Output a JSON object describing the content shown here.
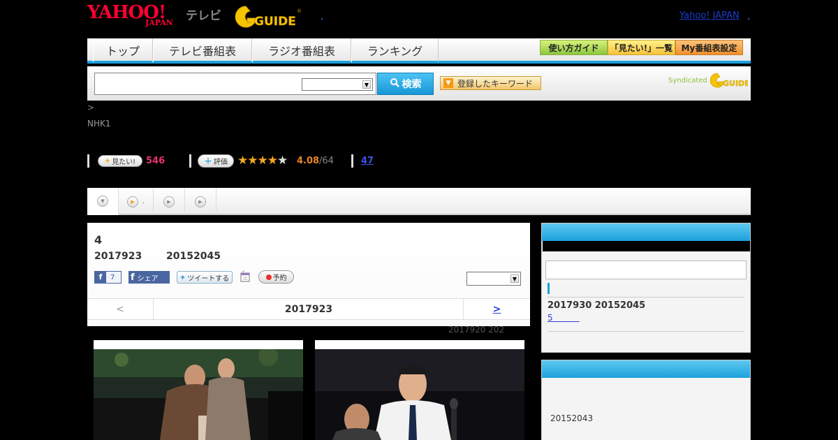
{
  "header": {
    "yahoo_logo": "YAHOO!",
    "japan_logo": "JAPAN",
    "tv_logo": "テレビ",
    "gguide_logo": "GUIDE",
    "yahoo_japan_link": "Yahoo! JAPAN"
  },
  "nav": {
    "tabs": [
      {
        "label": "トップ"
      },
      {
        "label": "テレビ番組表"
      },
      {
        "label": "ラジオ番組表"
      },
      {
        "label": "ランキング"
      }
    ],
    "buttons": [
      {
        "label": "使い方ガイド"
      },
      {
        "label": "「見たい!」一覧"
      },
      {
        "label": "My番組表設定"
      }
    ]
  },
  "search": {
    "input_value": "",
    "select_value": "",
    "button_label": "検索",
    "keyword_button_label": "登録したキーワード",
    "syndicated_label": "Syndicated"
  },
  "breadcrumb": ">",
  "channel": "NHK1",
  "stats": {
    "mitai_label": "見たい!",
    "mitai_count": "546",
    "eval_label": "評価",
    "rating": 4.08,
    "rating_text": "4.08",
    "rating_count": "/64",
    "reviews_count": "47"
  },
  "tabstrip": {
    "tab2_label": "."
  },
  "episode": {
    "title": "4",
    "date": "2017923",
    "time": "20152045",
    "fb_like_count": "7",
    "fb_share_label": "シェア",
    "tweet_label": "ツイートする",
    "reserve_label": "予約",
    "select_value": ""
  },
  "pager": {
    "prev": "<",
    "current": "2017923",
    "next": ">"
  },
  "faded_text": "2017920  202",
  "sidebar": {
    "next_date": "2017930  20152045",
    "next_link": "5",
    "box2_text": "20152043"
  },
  "colors": {
    "accent_blue": "#1ba0dc",
    "star": "#f5a623",
    "mitai_pink": "#e8336d"
  }
}
